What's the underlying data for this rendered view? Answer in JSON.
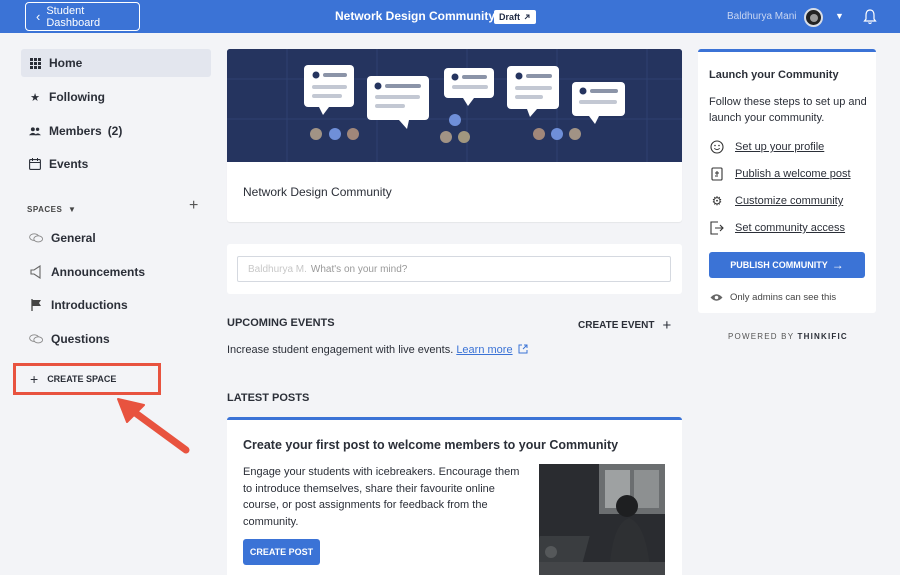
{
  "topbar": {
    "back_label": "Student Dashboard",
    "title": "Network Design Community",
    "draft_label": "Draft",
    "user_name": "Baldhurya Mani",
    "accent": "#3b73d6"
  },
  "sidebar": {
    "items": [
      {
        "label": "Home",
        "icon": "grid-icon"
      },
      {
        "label": "Following",
        "icon": "star-icon"
      },
      {
        "label": "Members",
        "count": "(2)",
        "icon": "people-icon"
      },
      {
        "label": "Events",
        "icon": "calendar-icon"
      }
    ],
    "spaces_label": "SPACES",
    "spaces": [
      {
        "label": "General",
        "icon": "chat-bubbles-icon"
      },
      {
        "label": "Announcements",
        "icon": "megaphone-icon"
      },
      {
        "label": "Introductions",
        "icon": "flag-icon"
      },
      {
        "label": "Questions",
        "icon": "chat-bubbles-icon"
      }
    ],
    "create_space_label": "CREATE SPACE"
  },
  "main": {
    "hero_title": "Network Design Community",
    "post_placeholder": "What's on your mind?",
    "post_prefix_blurred": "Baldhurya M.",
    "upcoming_title": "UPCOMING EVENTS",
    "create_event_label": "CREATE EVENT",
    "events_text": "Increase student engagement with live events.",
    "learn_more": "Learn more",
    "latest_title": "LATEST POSTS",
    "latest_card": {
      "heading": "Create your first post to welcome members to your Community",
      "body": "Engage your students with icebreakers. Encourage them to introduce themselves, share their favourite online course, or post assignments for feedback from the community.",
      "button": "CREATE POST"
    }
  },
  "launch": {
    "title": "Launch your Community",
    "desc": "Follow these steps to set up and launch your community.",
    "steps": [
      {
        "label": "Set up your profile",
        "icon": "smiley-icon"
      },
      {
        "label": "Publish a welcome post",
        "icon": "document-icon"
      },
      {
        "label": "Customize community",
        "icon": "gear-icon"
      },
      {
        "label": "Set community access",
        "icon": "exit-icon"
      }
    ],
    "publish_label": "PUBLISH COMMUNITY",
    "admins_note": "Only admins can see this"
  },
  "powered": {
    "prefix": "POWERED BY",
    "brand": "THINKIFIC"
  }
}
